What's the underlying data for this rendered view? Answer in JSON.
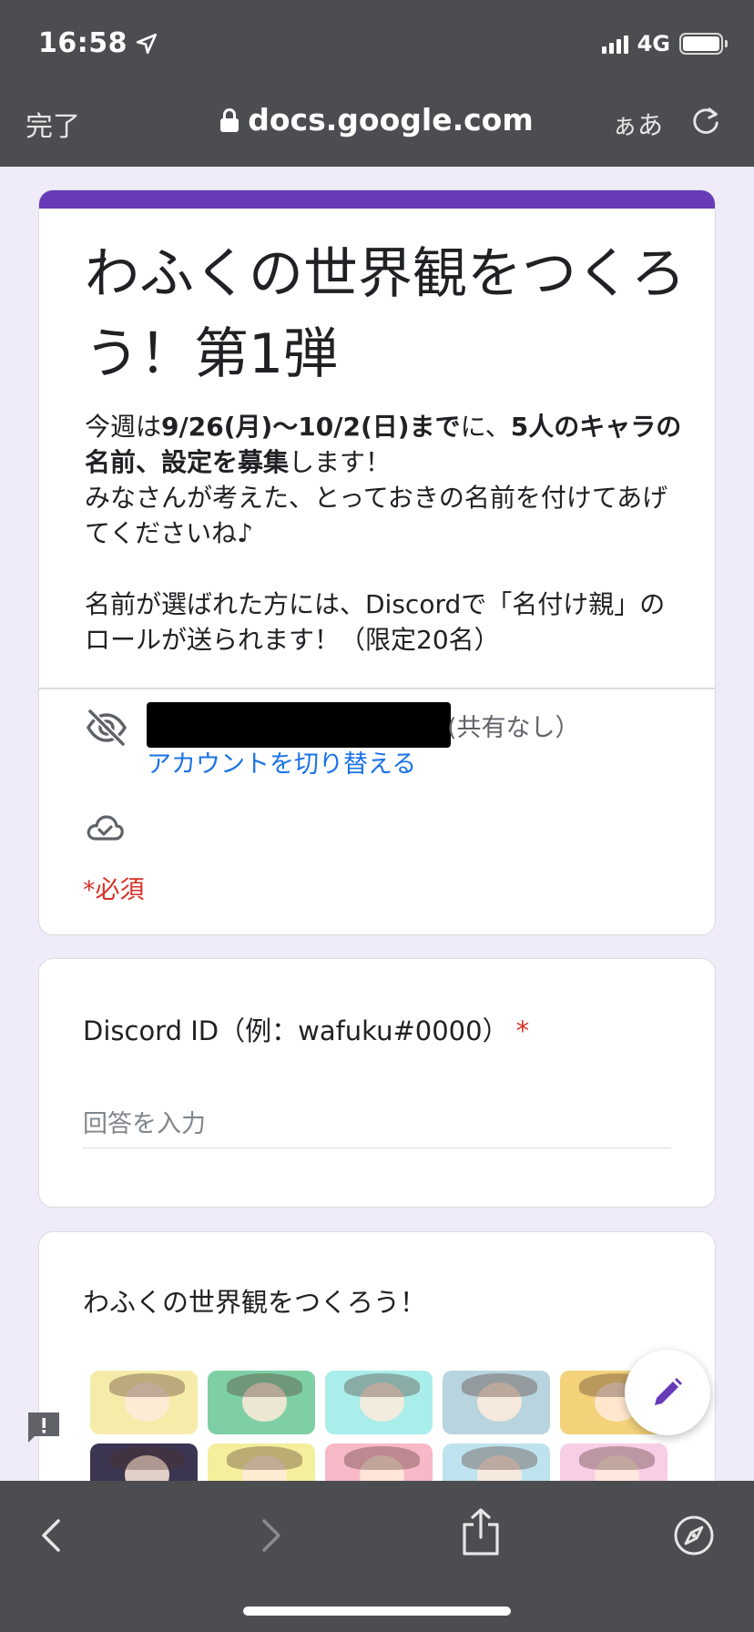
{
  "status_bar": {
    "time": "16:58",
    "network": "4G"
  },
  "browser": {
    "done_label": "完了",
    "url": "docs.google.com",
    "text_size_label": "ぁあ"
  },
  "form": {
    "accent_color": "#673ab7",
    "title": "わふくの世界観をつくろう！第1弾",
    "description": {
      "p1_a": "今週は",
      "p1_b": "9/26(月)〜10/2(日)まで",
      "p1_c": "に、",
      "p1_d": "5人のキャラの名前、設定を募集",
      "p1_e": "します！",
      "p2": "みなさんが考えた、とっておきの名前を付けてあげてくださいね♪",
      "p3": "名前が選ばれた方には、Discordで「名付け親」のロールが送られます！（限定20名）"
    },
    "account": {
      "unshared_label": "(共有なし）",
      "switch_account": "アカウントを切り替える"
    },
    "required_note": "*必須"
  },
  "question": {
    "label": "Discord ID（例：wafuku#0000）",
    "required_mark": "*",
    "placeholder": "回答を入力"
  },
  "section": {
    "title": "わふくの世界観をつくろう！"
  },
  "image_tiles": [
    "#f6ecaa",
    "#7fcfa4",
    "#a9eeea",
    "#b8d4de",
    "#f3d27a",
    "#3b3552",
    "#f4ef9c",
    "#f7b9c8",
    "#bfe3ee",
    "#f8cde6"
  ],
  "icons": [
    "location-arrow-icon",
    "lock-icon",
    "reload-icon",
    "eye-off-icon",
    "cloud-check-icon",
    "pencil-icon",
    "feedback-icon",
    "back-icon",
    "forward-icon",
    "share-icon",
    "compass-icon"
  ]
}
